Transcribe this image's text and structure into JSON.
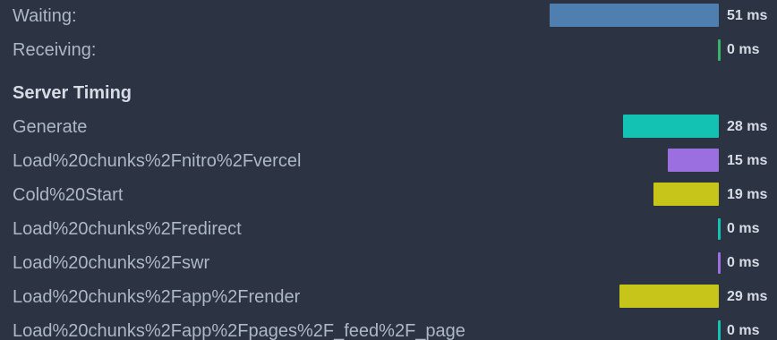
{
  "timing": {
    "waiting": {
      "label": "Waiting:",
      "value": "51 ms",
      "ms": 51,
      "color": "#4f7fb0"
    },
    "receiving": {
      "label": "Receiving:",
      "value": "0 ms",
      "ms": 0,
      "color": "#3ab36a"
    }
  },
  "server_timing": {
    "title": "Server Timing",
    "entries": [
      {
        "label": "Generate",
        "value": "28 ms",
        "ms": 28,
        "color": "#13c2b3"
      },
      {
        "label": "Load%20chunks%2Fnitro%2Fvercel",
        "value": "15 ms",
        "ms": 15,
        "color": "#9b6fe0"
      },
      {
        "label": "Cold%20Start",
        "value": "19 ms",
        "ms": 19,
        "color": "#c7c519"
      },
      {
        "label": "Load%20chunks%2Fredirect",
        "value": "0 ms",
        "ms": 0,
        "color": "#13c2b3"
      },
      {
        "label": "Load%20chunks%2Fswr",
        "value": "0 ms",
        "ms": 0,
        "color": "#9b6fe0"
      },
      {
        "label": "Load%20chunks%2Fapp%2Frender",
        "value": "29 ms",
        "ms": 29,
        "color": "#c7c519"
      },
      {
        "label": "Load%20chunks%2Fapp%2Fpages%2F_feed%2F_page",
        "value": "0 ms",
        "ms": 0,
        "color": "#13c2b3"
      }
    ]
  }
}
